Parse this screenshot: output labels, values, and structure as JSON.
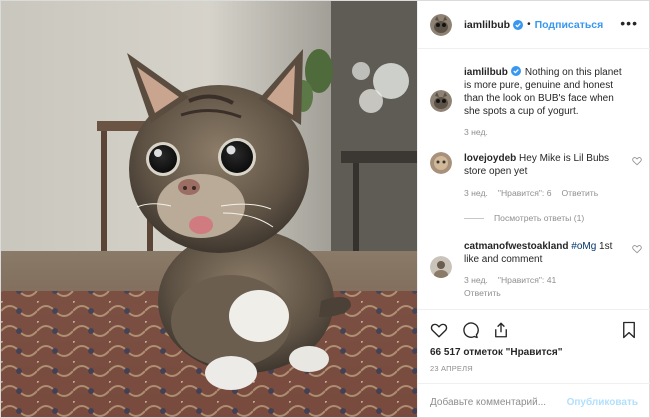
{
  "post": {
    "author": "iamlilbub",
    "dot": "•",
    "follow_label": "Подписаться",
    "more_label": "•••"
  },
  "caption": {
    "author": "iamlilbub",
    "text": "Nothing on this planet is more pure, genuine and honest than the look on BUB's face when she spots a cup of yogurt.",
    "time": "3 нед."
  },
  "comments": [
    {
      "author": "lovejoydeb",
      "text": "Hey Mike is Lil Bubs store open yet",
      "time": "3 нед.",
      "likes": "\"Нравится\": 6",
      "reply": "Ответить",
      "view_replies": "Посмотреть ответы (1)"
    },
    {
      "author": "catmanofwestoakland",
      "hashtag": "#oMg",
      "text": " 1st like and comment",
      "time": "3 нед.",
      "likes": "\"Нравится\": 41",
      "reply": "Ответить"
    }
  ],
  "footer": {
    "likes": "66 517 отметок \"Нравится\"",
    "date": "23 АПРЕЛЯ",
    "comment_placeholder": "Добавьте комментарий...",
    "publish_label": "Опубликовать"
  },
  "colors": {
    "accent": "#3897f0",
    "publish_disabled": "#b2dffc",
    "muted": "#8e8e8e"
  },
  "icons": [
    "verified-badge-icon",
    "heart-icon",
    "comment-icon",
    "share-icon",
    "bookmark-icon",
    "more-icon"
  ]
}
